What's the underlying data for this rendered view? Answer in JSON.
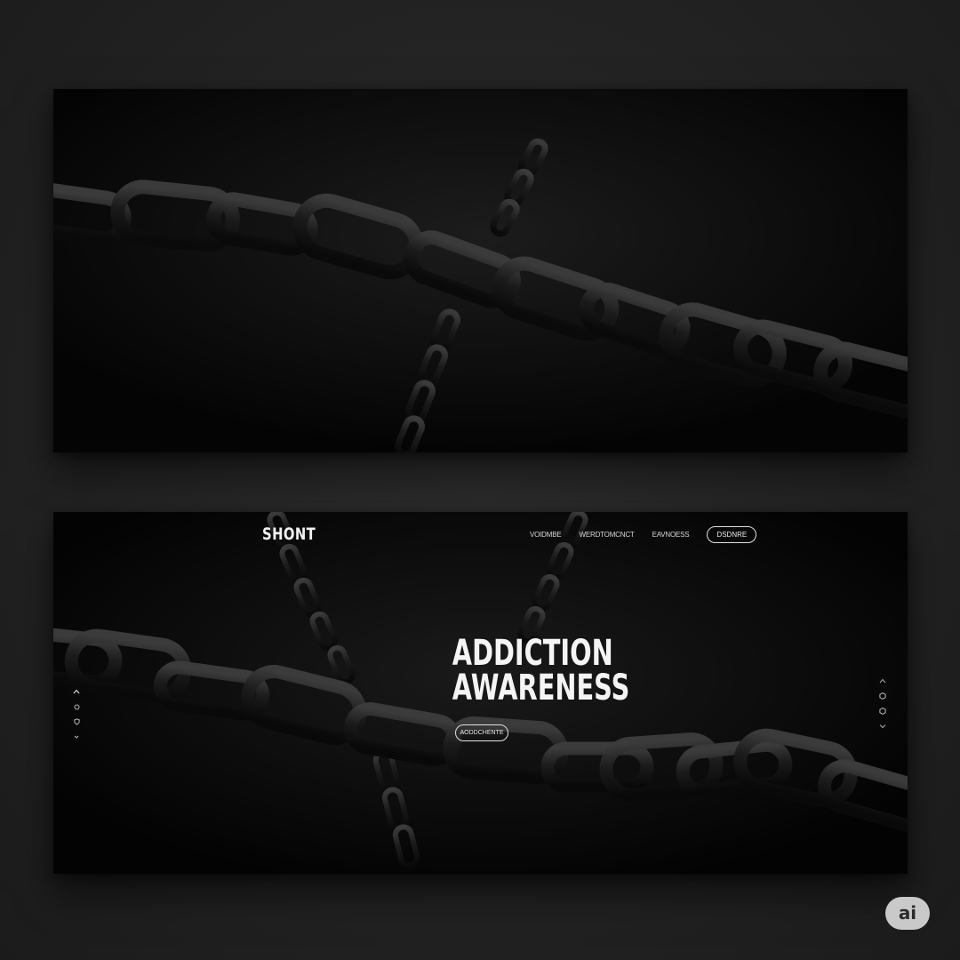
{
  "brand": "SHONT",
  "nav": {
    "links": [
      "VOIDMBE",
      "WERDTOMCNCT",
      "EAVNOESS"
    ],
    "cta": "DSDNRE"
  },
  "hero": {
    "title_line1": "ADDICTION",
    "title_line2": "AWARENESS",
    "cta": "AODDCHENTE"
  },
  "side_left_icons": [
    "chevron-up-icon",
    "circle-icon",
    "shield-icon",
    "chevron-down-icon"
  ],
  "side_right_icons": [
    "chevron-up-icon",
    "hexagon-icon",
    "hexagon-icon",
    "chevron-down-icon"
  ],
  "badge": "ai",
  "colors": {
    "background": "#232323",
    "panel": "#050505",
    "chain": "#1a1a1a",
    "text": "#f4f4f4"
  }
}
